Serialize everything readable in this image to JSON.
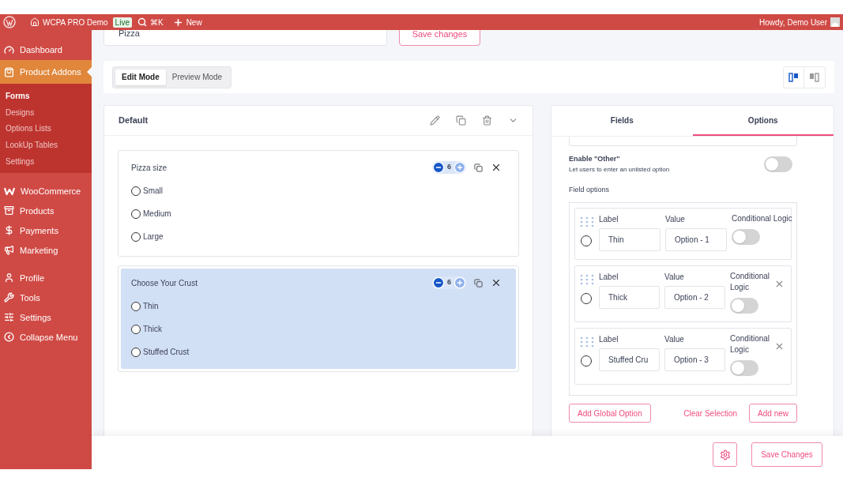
{
  "admin_bar": {
    "site": "WCPA PRO Demo",
    "badge": "Live",
    "shortcut": "⌘K",
    "new": "New",
    "greeting": "Howdy, Demo User"
  },
  "sidebar": {
    "items": [
      {
        "label": "Dashboard",
        "selected": false
      },
      {
        "label": "Product Addons",
        "selected": true,
        "children": [
          {
            "label": "Forms",
            "selected": true
          },
          {
            "label": "Designs",
            "selected": false
          },
          {
            "label": "Options Lists",
            "selected": false
          },
          {
            "label": "LookUp Tables",
            "selected": false
          },
          {
            "label": "Settings",
            "selected": false
          }
        ]
      },
      {
        "label": "WooCommerce",
        "selected": false
      },
      {
        "label": "Products",
        "selected": false
      },
      {
        "label": "Payments",
        "selected": false
      },
      {
        "label": "Marketing",
        "selected": false
      },
      {
        "label": "Profile",
        "selected": false
      },
      {
        "label": "Tools",
        "selected": false
      },
      {
        "label": "Settings",
        "selected": false
      },
      {
        "label": "Collapse Menu",
        "selected": false
      }
    ]
  },
  "top": {
    "form_name": "Pizza",
    "save_button": "Save changes"
  },
  "modes": [
    {
      "label": "Edit Mode",
      "selected": true
    },
    {
      "label": "Preview Mode",
      "selected": false
    }
  ],
  "layout_toggles": [
    {
      "selected": true
    },
    {
      "selected": false
    }
  ],
  "form": {
    "title": "Default",
    "fields": [
      {
        "label": "Pizza size",
        "count": "6",
        "selected": false,
        "options": [
          "Small",
          "Medium",
          "Large"
        ]
      },
      {
        "label": "Choose Your Crust",
        "count": "6",
        "selected": true,
        "options": [
          "Thin",
          "Thick",
          "Stuffed Crust"
        ]
      }
    ]
  },
  "panel": {
    "tabs": [
      {
        "label": "Fields",
        "selected": false
      },
      {
        "label": "Options",
        "selected": true
      }
    ],
    "enable_other": {
      "title": "Enable \"Other\"",
      "hint": "Let users to enter an unlisted option",
      "on": false
    },
    "field_options_label": "Field options",
    "rows": [
      {
        "selected": false,
        "label_caption": "Label",
        "label": "Thin",
        "value_caption": "Value",
        "value": "Option - 1",
        "logic_caption": "Conditional Logic",
        "logic_on": false,
        "removable": false
      },
      {
        "selected": false,
        "label_caption": "Label",
        "label": "Thick",
        "value_caption": "Value",
        "value": "Option - 2",
        "logic_caption": "Conditional Logic",
        "logic_on": false,
        "removable": true
      },
      {
        "selected": false,
        "label_caption": "Label",
        "label": "Stuffed Cru",
        "value_caption": "Value",
        "value": "Option - 3",
        "logic_caption": "Conditional Logic",
        "logic_on": false,
        "removable": true
      }
    ],
    "actions": {
      "add_global": "Add Global Option",
      "clear": "Clear Selection",
      "add_new": "Add new"
    }
  },
  "footer": {
    "save": "Save Changes"
  }
}
